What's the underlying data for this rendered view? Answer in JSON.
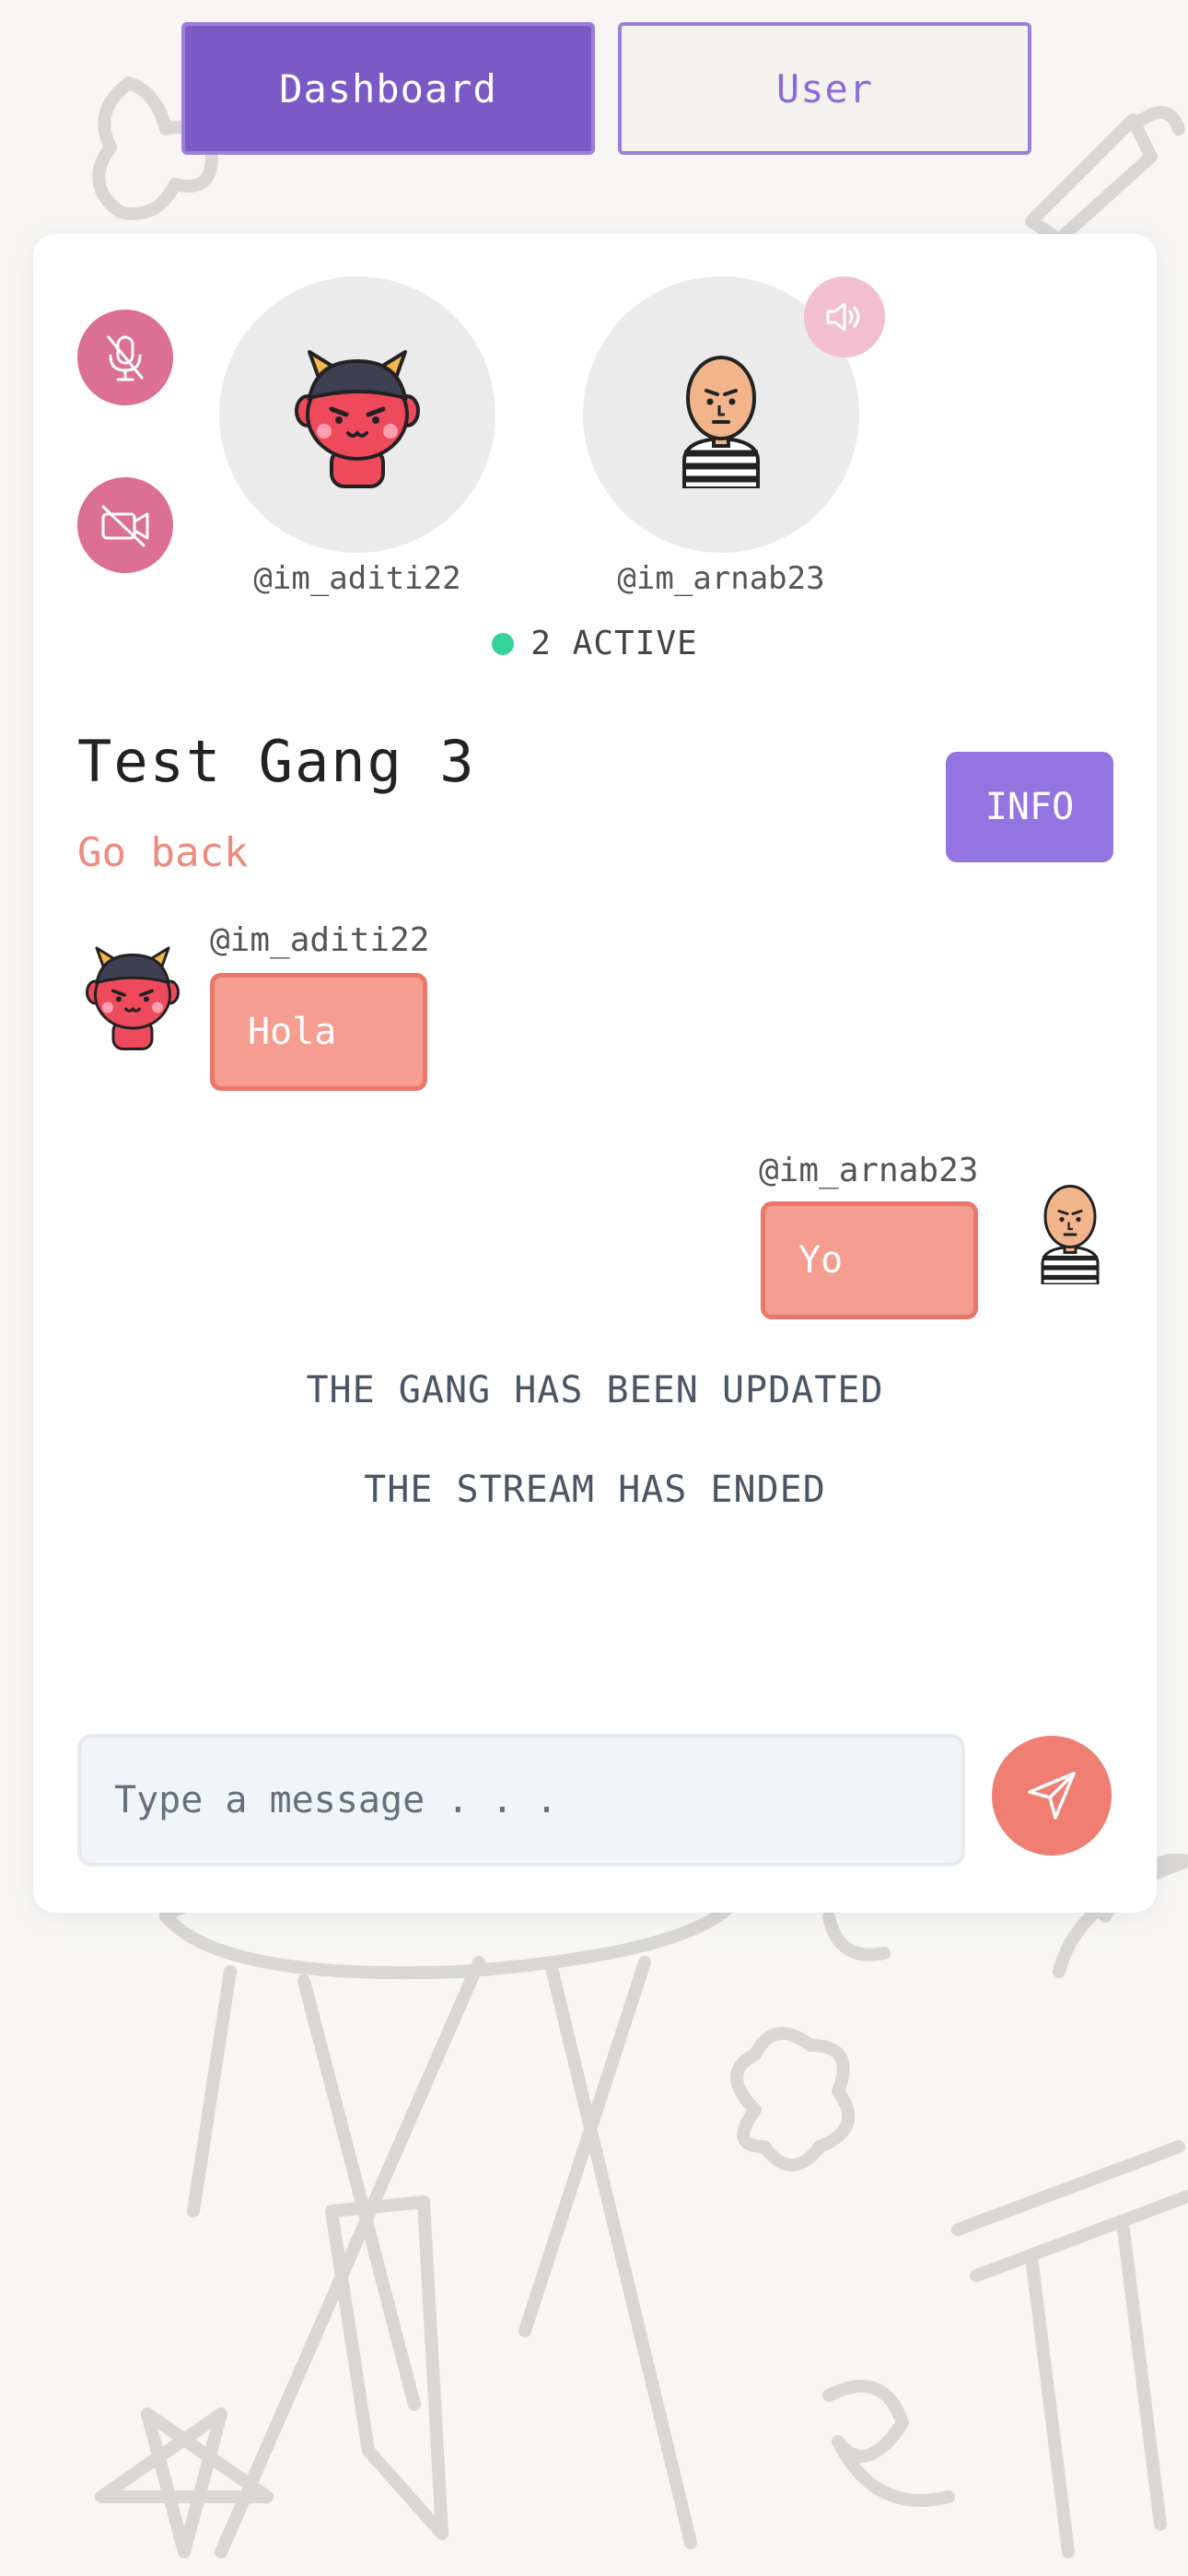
{
  "nav": {
    "tabs": [
      {
        "label": "Dashboard",
        "active": true
      },
      {
        "label": "User",
        "active": false
      }
    ]
  },
  "call": {
    "participants": [
      {
        "username": "@im_aditi22",
        "avatar": "devil-avatar"
      },
      {
        "username": "@im_arnab23",
        "avatar": "prisoner-avatar"
      }
    ],
    "active_count": "2 ACTIVE",
    "controls": {
      "mic": "mic-muted-icon",
      "camera": "camera-off-icon",
      "speaker": "speaker-icon"
    }
  },
  "gang": {
    "title": "Test Gang 3",
    "go_back": "Go back",
    "info_label": "INFO"
  },
  "messages": [
    {
      "username": "@im_aditi22",
      "text": "Hola",
      "side": "left"
    },
    {
      "username": "@im_arnab23",
      "text": "Yo",
      "side": "right"
    }
  ],
  "system_messages": [
    "THE GANG HAS BEEN UPDATED",
    "THE STREAM HAS ENDED"
  ],
  "composer": {
    "placeholder": "Type a message . . ."
  },
  "colors": {
    "primary": "#7c5ac5",
    "accent": "#f07e72",
    "control": "#dc6f94",
    "bubble": "#f49d90",
    "active": "#34d399"
  }
}
